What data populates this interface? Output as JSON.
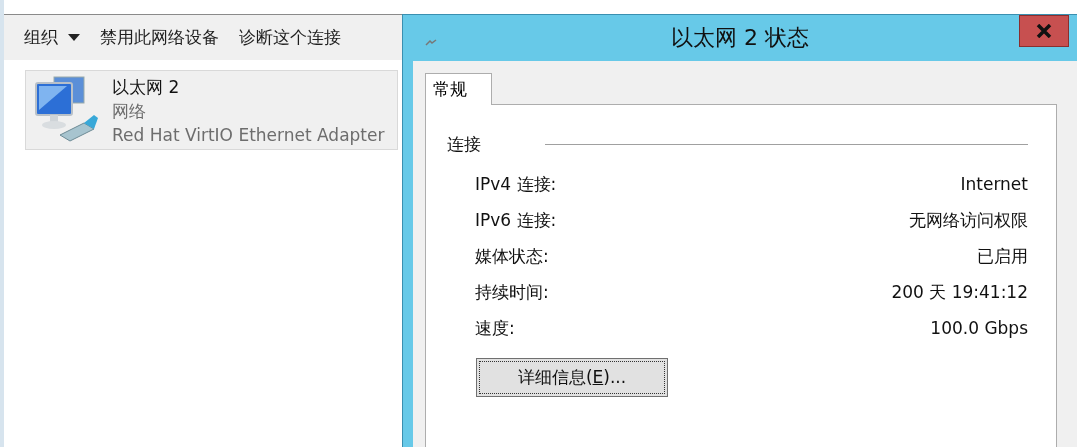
{
  "explorer": {
    "toolbar": [
      {
        "label": "组织",
        "kind": "menu"
      },
      {
        "label": "禁用此网络设备",
        "kind": "plain"
      },
      {
        "label": "诊断这个连接",
        "kind": "plain"
      }
    ],
    "items": [
      {
        "name": "以太网 2",
        "status": "网络",
        "adapter": "Red Hat VirtIO Ethernet Adapter",
        "selected": true
      }
    ]
  },
  "dialog": {
    "title": "以太网 2 状态",
    "tabs": [
      {
        "label": "常规",
        "selected": true
      }
    ],
    "section": "连接",
    "rows": [
      {
        "label": "IPv4 连接:",
        "value": "Internet"
      },
      {
        "label": "IPv6 连接:",
        "value": "无网络访问权限"
      },
      {
        "label": "媒体状态:",
        "value": "已启用"
      },
      {
        "label": "持续时间:",
        "value": "200 天 19:41:12"
      },
      {
        "label": "速度:",
        "value": "100.0 Gbps"
      }
    ],
    "details_button": {
      "label_parts": [
        {
          "text": "详细信息(",
          "underlined": false
        },
        {
          "text": "E",
          "underlined": true
        },
        {
          "text": ")...",
          "underlined": false
        }
      ]
    }
  }
}
